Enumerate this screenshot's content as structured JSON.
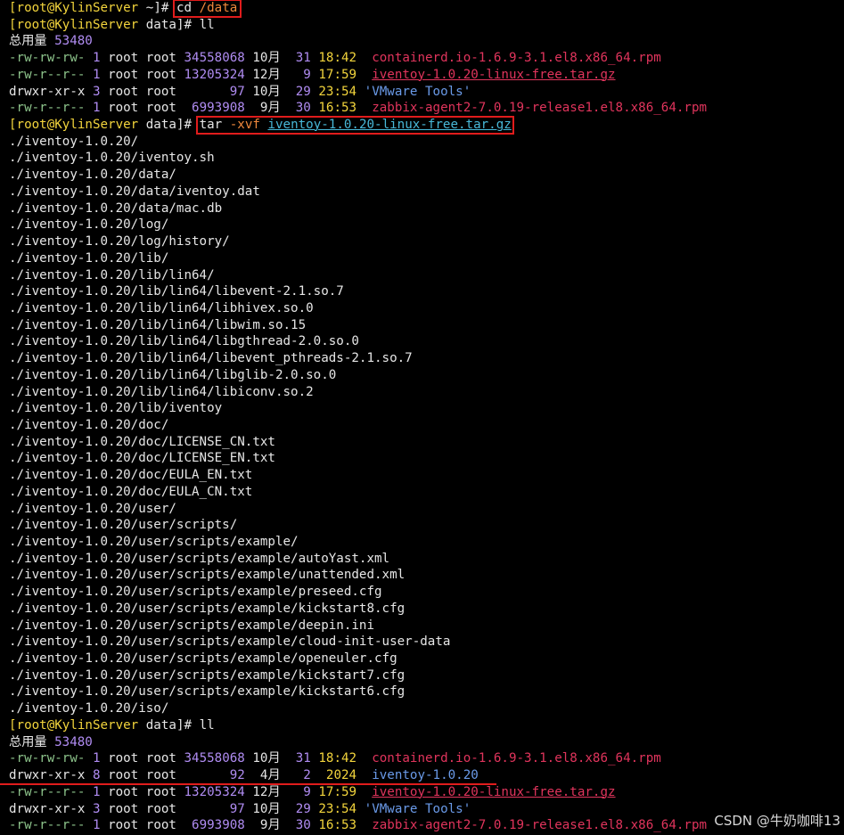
{
  "prompt": {
    "user_host": "[root@KylinServer",
    "home_dir": "~",
    "data_dir": "data",
    "close": "]#"
  },
  "commands": {
    "cd": {
      "cmd": "cd",
      "arg": "/data"
    },
    "ll": "ll",
    "tar": {
      "cmd": "tar",
      "flag": "-xvf",
      "arg": "iventoy-1.0.20-linux-free.tar.gz"
    }
  },
  "listing1": {
    "total_label": "总用量",
    "total_value": "53480",
    "rows": [
      {
        "perm": "-rw-rw-rw-",
        "links": "1",
        "owner": "root",
        "group": "root",
        "size": "34558068",
        "month": "10月",
        "day": "31",
        "time": "18:42",
        "name": "containerd.io-1.6.9-3.1.el8.x86_64.rpm",
        "style": "m"
      },
      {
        "perm": "-rw-r--r--",
        "links": "1",
        "owner": "root",
        "group": "root",
        "size": "13205324",
        "month": "12月",
        "day": "9",
        "time": "17:59",
        "name": "iventoy-1.0.20-linux-free.tar.gz",
        "style": "mu"
      },
      {
        "perm": "drwxr-xr-x",
        "links": "3",
        "owner": "root",
        "group": "root",
        "size": "97",
        "month": "10月",
        "day": "29",
        "time": "23:54",
        "name": "'VMware Tools'",
        "style": "bl"
      },
      {
        "perm": "-rw-r--r--",
        "links": "1",
        "owner": "root",
        "group": "root",
        "size": "6993908",
        "month": "9月",
        "day": "30",
        "time": "16:53",
        "name": "zabbix-agent2-7.0.19-release1.el8.x86_64.rpm",
        "style": "m"
      }
    ]
  },
  "tar_output": [
    "./iventoy-1.0.20/",
    "./iventoy-1.0.20/iventoy.sh",
    "./iventoy-1.0.20/data/",
    "./iventoy-1.0.20/data/iventoy.dat",
    "./iventoy-1.0.20/data/mac.db",
    "./iventoy-1.0.20/log/",
    "./iventoy-1.0.20/log/history/",
    "./iventoy-1.0.20/lib/",
    "./iventoy-1.0.20/lib/lin64/",
    "./iventoy-1.0.20/lib/lin64/libevent-2.1.so.7",
    "./iventoy-1.0.20/lib/lin64/libhivex.so.0",
    "./iventoy-1.0.20/lib/lin64/libwim.so.15",
    "./iventoy-1.0.20/lib/lin64/libgthread-2.0.so.0",
    "./iventoy-1.0.20/lib/lin64/libevent_pthreads-2.1.so.7",
    "./iventoy-1.0.20/lib/lin64/libglib-2.0.so.0",
    "./iventoy-1.0.20/lib/lin64/libiconv.so.2",
    "./iventoy-1.0.20/lib/iventoy",
    "./iventoy-1.0.20/doc/",
    "./iventoy-1.0.20/doc/LICENSE_CN.txt",
    "./iventoy-1.0.20/doc/LICENSE_EN.txt",
    "./iventoy-1.0.20/doc/EULA_EN.txt",
    "./iventoy-1.0.20/doc/EULA_CN.txt",
    "./iventoy-1.0.20/user/",
    "./iventoy-1.0.20/user/scripts/",
    "./iventoy-1.0.20/user/scripts/example/",
    "./iventoy-1.0.20/user/scripts/example/autoYast.xml",
    "./iventoy-1.0.20/user/scripts/example/unattended.xml",
    "./iventoy-1.0.20/user/scripts/example/preseed.cfg",
    "./iventoy-1.0.20/user/scripts/example/kickstart8.cfg",
    "./iventoy-1.0.20/user/scripts/example/deepin.ini",
    "./iventoy-1.0.20/user/scripts/example/cloud-init-user-data",
    "./iventoy-1.0.20/user/scripts/example/openeuler.cfg",
    "./iventoy-1.0.20/user/scripts/example/kickstart7.cfg",
    "./iventoy-1.0.20/user/scripts/example/kickstart6.cfg",
    "./iventoy-1.0.20/iso/"
  ],
  "listing2": {
    "total_label": "总用量",
    "total_value": "53480",
    "rows": [
      {
        "perm": "-rw-rw-rw-",
        "links": "1",
        "owner": "root",
        "group": "root",
        "size": "34558068",
        "month": "10月",
        "day": "31",
        "time": "18:42",
        "name": "containerd.io-1.6.9-3.1.el8.x86_64.rpm",
        "style": "m"
      },
      {
        "perm": "drwxr-xr-x",
        "links": "8",
        "owner": "root",
        "group": "root",
        "size": "92",
        "month": "4月",
        "day": "2",
        "time": "2024",
        "name": "iventoy-1.0.20",
        "style": "bl"
      },
      {
        "perm": "-rw-r--r--",
        "links": "1",
        "owner": "root",
        "group": "root",
        "size": "13205324",
        "month": "12月",
        "day": "9",
        "time": "17:59",
        "name": "iventoy-1.0.20-linux-free.tar.gz",
        "style": "mu"
      },
      {
        "perm": "drwxr-xr-x",
        "links": "3",
        "owner": "root",
        "group": "root",
        "size": "97",
        "month": "10月",
        "day": "29",
        "time": "23:54",
        "name": "'VMware Tools'",
        "style": "bl"
      },
      {
        "perm": "-rw-r--r--",
        "links": "1",
        "owner": "root",
        "group": "root",
        "size": "6993908",
        "month": "9月",
        "day": "30",
        "time": "16:53",
        "name": "zabbix-agent2-7.0.19-release1.el8.x86_64.rpm",
        "style": "m"
      }
    ]
  },
  "watermark": "CSDN @牛奶咖啡13",
  "colors": {
    "background": "#000000",
    "prompt": "#f2d43c",
    "text": "#e6e6e6",
    "permission": "#8dc48b",
    "number": "#b08cf2",
    "archive": "#e0345c",
    "directory": "#6a9ae8",
    "argument": "#48b8d8",
    "highlight_box": "#e01c1c"
  }
}
